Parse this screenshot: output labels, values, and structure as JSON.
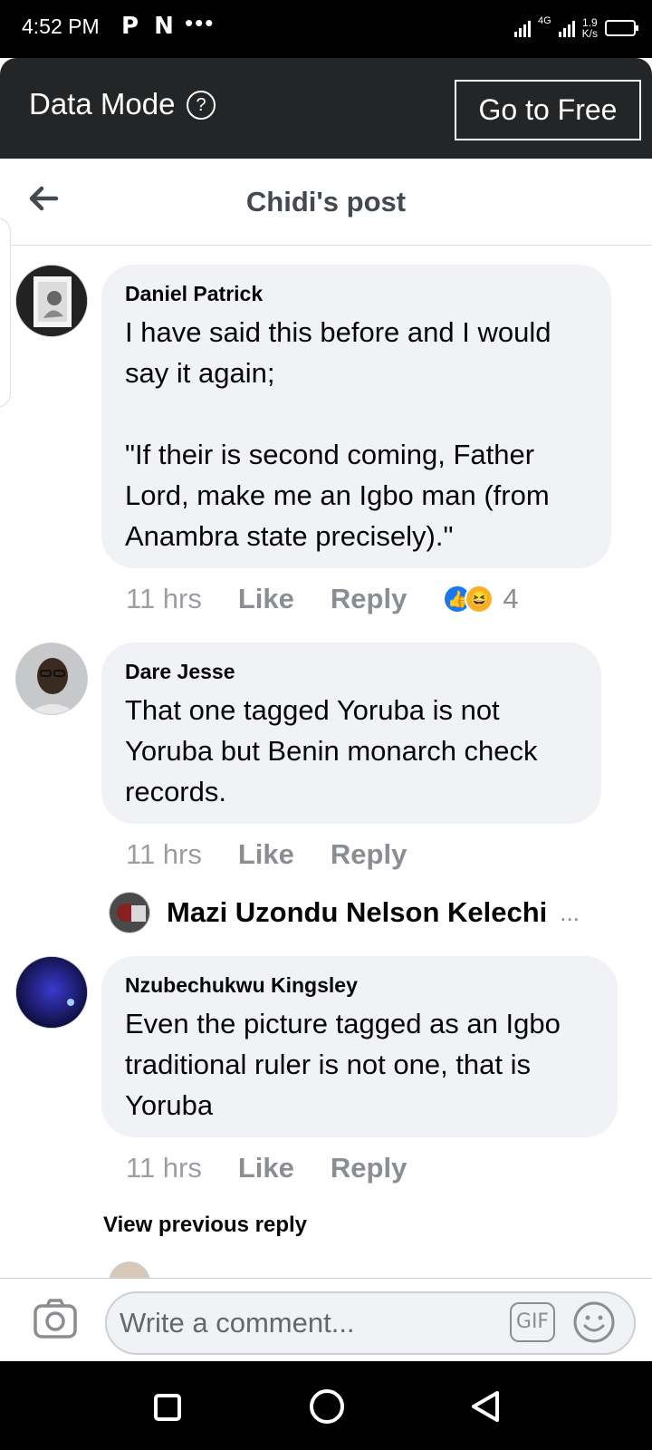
{
  "status_bar": {
    "time": "4:52 PM",
    "app_icons": "P N",
    "more": "•••",
    "network": "4G",
    "speed_value": "1.9",
    "speed_unit": "K/s"
  },
  "data_mode": {
    "label": "Data Mode",
    "help": "?",
    "go_free_label": "Go to Free"
  },
  "header": {
    "title": "Chidi's post"
  },
  "comments": [
    {
      "author": "Daniel Patrick",
      "text": "I have said this before and I would say it again;\n\n\"If their is second coming, Father Lord, make me an Igbo man (from Anambra state precisely).\"",
      "time": "11 hrs",
      "like": "Like",
      "reply": "Reply",
      "reaction_count": "4"
    },
    {
      "author": "Dare Jesse",
      "text": "That one tagged Yoruba is not Yoruba but Benin monarch check records.",
      "time": "11 hrs",
      "like": "Like",
      "reply": "Reply"
    },
    {
      "author": "Nzubechukwu Kingsley",
      "text": "Even the picture tagged as an Igbo traditional ruler is not one, that is Yoruba",
      "time": "11 hrs",
      "like": "Like",
      "reply": "Reply"
    }
  ],
  "reply_preview": {
    "name": "Mazi Uzondu Nelson Kelechi",
    "more": "..."
  },
  "view_previous_reply": "View previous reply",
  "composer": {
    "placeholder": "Write a comment...",
    "gif": "GIF"
  },
  "colors": {
    "bubble": "#f0f2f5",
    "header_dark": "#242526",
    "muted": "#8a8d91",
    "like_blue": "#1877f2",
    "haha_yellow": "#f7b125"
  }
}
